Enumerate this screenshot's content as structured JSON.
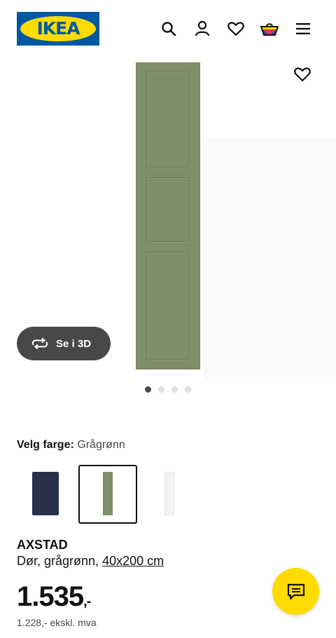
{
  "header": {
    "logo_text": "IKEA",
    "icons": [
      "search-icon",
      "user-icon",
      "heart-icon",
      "basket-icon",
      "menu-icon"
    ]
  },
  "gallery": {
    "view_3d_label": "Se i 3D",
    "favourite_icon": "heart-icon",
    "dots_total": 4,
    "dots_active_index": 0
  },
  "colors": {
    "label": "Velg farge:",
    "selected": "Grågrønn",
    "swatch_colors": [
      "#27314a",
      "#7f8f6a",
      "#f1f1f1"
    ],
    "selected_index": 1
  },
  "product": {
    "name": "AXSTAD",
    "description": "Dør, grågrønn,",
    "size": "40x200 cm",
    "price": "1.535",
    "price_suffix": ",-",
    "price_ex_vat": "1.228,- ekskl. mva"
  },
  "theme": {
    "brand_blue": "#0058a3",
    "brand_yellow": "#ffdb00",
    "door_color": "#7f8f6a"
  }
}
